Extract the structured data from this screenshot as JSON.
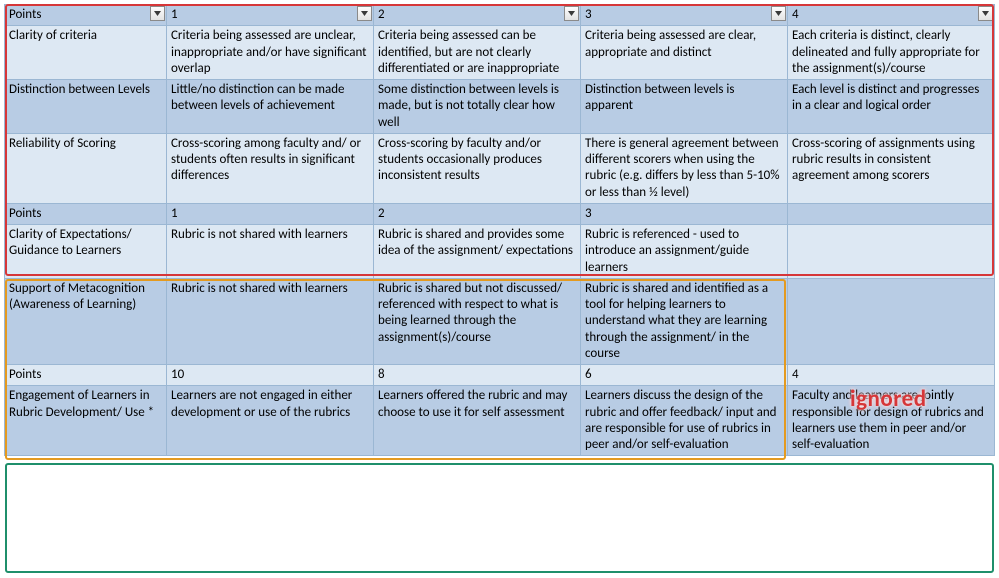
{
  "grid": {
    "headers": {
      "h0": "Points",
      "h1": "1",
      "h2": "2",
      "h3": "3",
      "h4": "4"
    },
    "s1": {
      "r0": {
        "label": "Clarity of criteria",
        "c1": "Criteria being assessed are unclear, inappropriate and/or have significant overlap",
        "c2": "Criteria being assessed can be identified, but are not clearly differentiated or are inappropriate",
        "c3": "Criteria being assessed are clear, appropriate and distinct",
        "c4": "Each criteria is distinct, clearly delineated and fully appropriate for the assignment(s)/course"
      },
      "r1": {
        "label": "Distinction between Levels",
        "c1": "Little/no distinction can be made between levels of achievement",
        "c2": "Some distinction between levels is made, but is not totally clear how well",
        "c3": "Distinction between levels is apparent",
        "c4": "Each level is distinct and progresses in a clear and logical order"
      },
      "r2": {
        "label": "Reliability of Scoring",
        "c1": "Cross-scoring among faculty and/ or students often results in significant differences",
        "c2": "Cross-scoring by faculty and/or students occasionally produces inconsistent results",
        "c3": "There is general agreement between different scorers when using the rubric (e.g. differs by less than 5-10% or less than ½ level)",
        "c4": "Cross-scoring of assignments using rubric results in consistent agreement among scorers"
      }
    },
    "s2hdr": {
      "h0": "Points",
      "h1": "1",
      "h2": "2",
      "h3": "3",
      "h4": ""
    },
    "s2": {
      "r0": {
        "label": "Clarity of Expectations/ Guidance to Learners",
        "c1": "Rubric is not shared with learners",
        "c2": "Rubric is shared and provides some idea of the assignment/ expectations",
        "c3": "Rubric is referenced - used to introduce an assignment/guide learners",
        "c4": ""
      },
      "r1": {
        "label": "Support of Metacognition (Awareness of Learning)",
        "c1": "Rubric is not shared with learners",
        "c2": "Rubric is shared but not discussed/ referenced with respect to what is being learned through the assignment(s)/course",
        "c3": "Rubric is shared and identified as a tool for helping learners to understand what they are learning through the assignment/ in the course",
        "c4": ""
      }
    },
    "s3hdr": {
      "h0": "Points",
      "h1": "10",
      "h2": "8",
      "h3": "6",
      "h4": "4"
    },
    "s3": {
      "r0": {
        "label": "Engagement of Learners in Rubric Development/ Use *",
        "c1": "Learners are not engaged in either development or use of the rubrics",
        "c2": "Learners offered the rubric and may choose to use it for self assessment",
        "c3": "Learners discuss the design of the rubric and offer feedback/ input and are responsible for use of rubrics in peer and/or self-evaluation",
        "c4": "Faculty and learners are jointly responsible for design of rubrics and learners use them in peer and/or self-evaluation"
      }
    }
  },
  "annotations": {
    "ignored": "ignored"
  },
  "chart_data": {
    "type": "table",
    "blocks": [
      {
        "scale": [
          1,
          2,
          3,
          4
        ],
        "rows": [
          {
            "criterion": "Clarity of criteria",
            "1": "Criteria being assessed are unclear, inappropriate and/or have significant overlap",
            "2": "Criteria being assessed can be identified, but are not clearly differentiated or are inappropriate",
            "3": "Criteria being assessed are clear, appropriate and distinct",
            "4": "Each criteria is distinct, clearly delineated and fully appropriate for the assignment(s)/course"
          },
          {
            "criterion": "Distinction between Levels",
            "1": "Little/no distinction can be made between levels of achievement",
            "2": "Some distinction between levels is made, but is not totally clear how well",
            "3": "Distinction between levels is apparent",
            "4": "Each level is distinct and progresses in a clear and logical order"
          },
          {
            "criterion": "Reliability of Scoring",
            "1": "Cross-scoring among faculty and/ or students often results in significant differences",
            "2": "Cross-scoring by faculty and/or students occasionally produces inconsistent results",
            "3": "There is general agreement between different scorers when using the rubric (e.g. differs by less than 5-10% or less than ½ level)",
            "4": "Cross-scoring of assignments using rubric results in consistent agreement among scorers"
          }
        ]
      },
      {
        "scale": [
          1,
          2,
          3
        ],
        "rows": [
          {
            "criterion": "Clarity of Expectations/ Guidance to Learners",
            "1": "Rubric is not shared with learners",
            "2": "Rubric is shared and provides some idea of the assignment/ expectations",
            "3": "Rubric is referenced - used to introduce an assignment/guide learners"
          },
          {
            "criterion": "Support of Metacognition (Awareness of Learning)",
            "1": "Rubric is not shared with learners",
            "2": "Rubric is shared but not discussed/ referenced with respect to what is being learned through the assignment(s)/course",
            "3": "Rubric is shared and identified as a tool for helping learners to understand what they are learning through the assignment/ in the course"
          }
        ]
      },
      {
        "scale": [
          10,
          8,
          6,
          4
        ],
        "rows": [
          {
            "criterion": "Engagement of Learners in Rubric Development/ Use *",
            "10": "Learners are not engaged in either development or use of the rubrics",
            "8": "Learners offered the rubric and may choose to use it for self assessment",
            "6": "Learners discuss the design of the rubric and offer feedback/ input and are responsible for use of rubrics in peer and/or self-evaluation",
            "4": "Faculty and learners are jointly responsible for design of rubrics and learners use them in peer and/or self-evaluation"
          }
        ]
      }
    ]
  }
}
